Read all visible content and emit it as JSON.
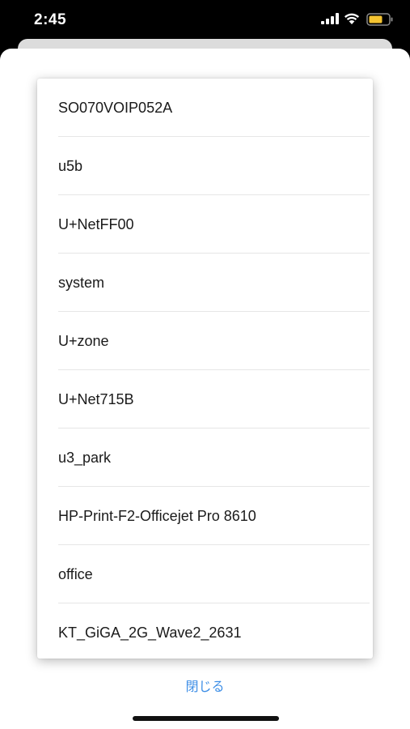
{
  "status_bar": {
    "time": "2:45",
    "icons": [
      "signal-icon",
      "wifi-icon",
      "battery-icon"
    ],
    "battery_color": "#f5c431"
  },
  "network_list": {
    "items": [
      "SO070VOIP052A",
      "u5b",
      "U+NetFF00",
      "system",
      "U+zone",
      "U+Net715B",
      "u3_park",
      "HP-Print-F2-Officejet Pro 8610",
      "office",
      "KT_GiGA_2G_Wave2_2631"
    ]
  },
  "close_label": "閉じる",
  "colors": {
    "accent": "#3d8ee6",
    "background": "#000000",
    "sheet": "#ffffff"
  }
}
